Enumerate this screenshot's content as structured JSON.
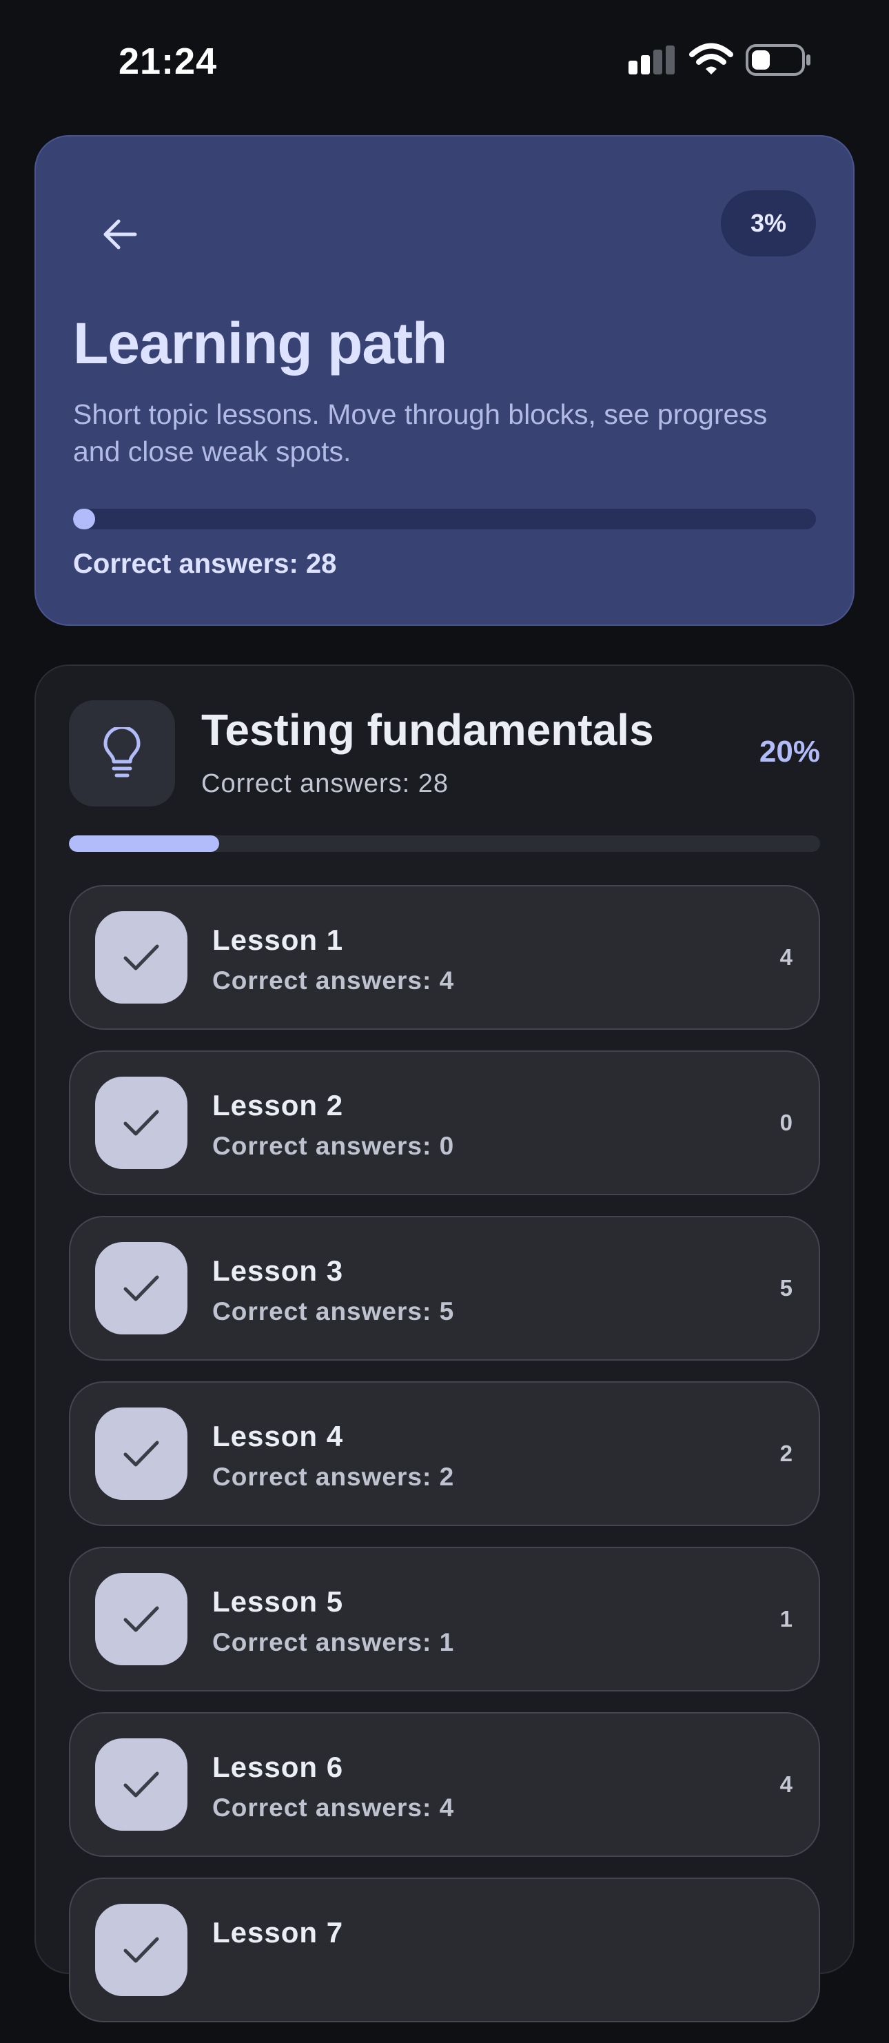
{
  "status_bar": {
    "time": "21:24",
    "icons": [
      "cellular-signal-icon",
      "wifi-icon",
      "battery-icon"
    ]
  },
  "header": {
    "back_icon": "arrow-left-icon",
    "progress_badge": "3%",
    "progress_fraction": 0.03,
    "title": "Learning path",
    "subtitle": "Short topic lessons. Move through blocks, see progress and close weak spots.",
    "correct_answers": "Correct answers: 28"
  },
  "section": {
    "icon": "lightbulb-icon",
    "title": "Testing fundamentals",
    "correct_answers": "Correct answers: 28",
    "percent": "20%",
    "progress_fraction": 0.2,
    "lessons": [
      {
        "name": "Lesson 1",
        "correct": "Correct answers: 4",
        "score": "4",
        "icon": "checkmark-icon"
      },
      {
        "name": "Lesson 2",
        "correct": "Correct answers: 0",
        "score": "0",
        "icon": "checkmark-icon"
      },
      {
        "name": "Lesson 3",
        "correct": "Correct answers: 5",
        "score": "5",
        "icon": "checkmark-icon"
      },
      {
        "name": "Lesson 4",
        "correct": "Correct answers: 2",
        "score": "2",
        "icon": "checkmark-icon"
      },
      {
        "name": "Lesson 5",
        "correct": "Correct answers: 1",
        "score": "1",
        "icon": "checkmark-icon"
      },
      {
        "name": "Lesson 6",
        "correct": "Correct answers: 4",
        "score": "4",
        "icon": "checkmark-icon"
      },
      {
        "name": "Lesson 7",
        "correct": "",
        "score": "",
        "icon": "checkmark-icon"
      }
    ]
  },
  "colors": {
    "background": "#0f1014",
    "header_card": "#384273",
    "accent": "#b3bcfa",
    "section_card": "#1b1c21",
    "lesson_row": "#2a2b31"
  }
}
